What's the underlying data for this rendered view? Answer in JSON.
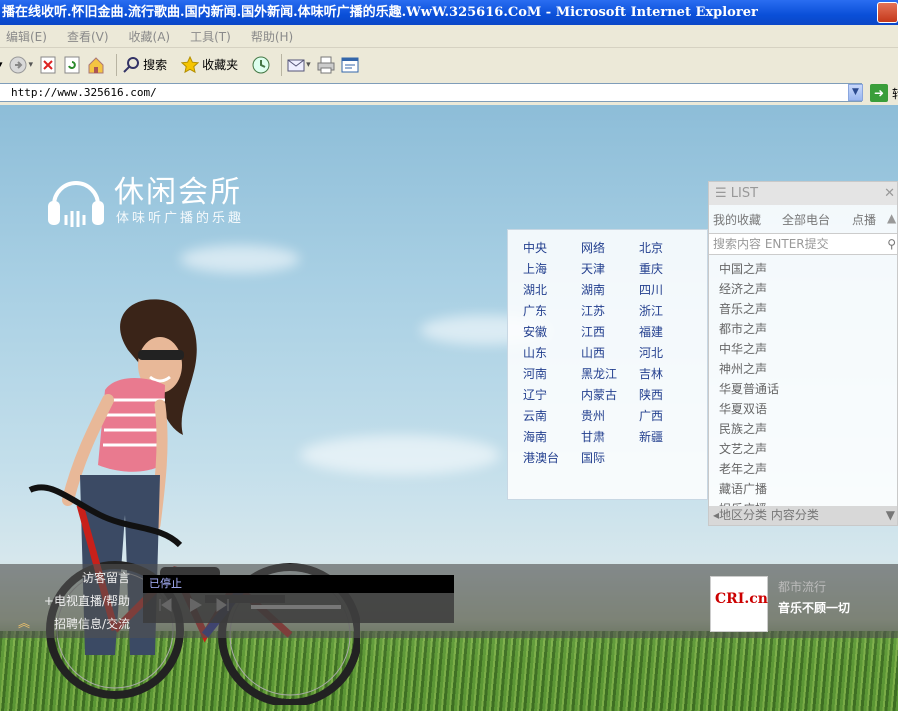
{
  "window": {
    "title": "播在线收听.怀旧金曲.流行歌曲.国内新闻.国外新闻.体味听广播的乐趣.WwW.325616.CoM - Microsoft Internet Explorer"
  },
  "menu": {
    "items": [
      "编辑(E)",
      "查看(V)",
      "收藏(A)",
      "工具(T)",
      "帮助(H)"
    ]
  },
  "toolbar": {
    "search_label": "搜索",
    "favorites_label": "收藏夹"
  },
  "address": {
    "url": "http://www.325616.com/",
    "go_label": "转"
  },
  "site": {
    "logo_title": "休闲会所",
    "logo_subtitle": "体味听广播的乐趣"
  },
  "regions": {
    "col1": [
      "中央",
      "上海",
      "湖北",
      "广东",
      "安徽",
      "山东",
      "河南",
      "辽宁",
      "云南",
      "海南",
      "港澳台"
    ],
    "col2": [
      "网络",
      "天津",
      "湖南",
      "江苏",
      "江西",
      "山西",
      "黑龙江",
      "内蒙古",
      "贵州",
      "甘肃",
      "国际"
    ],
    "col3": [
      "北京",
      "重庆",
      "四川",
      "浙江",
      "福建",
      "河北",
      "吉林",
      "陕西",
      "广西",
      "新疆"
    ]
  },
  "list": {
    "title": "LIST",
    "tab_favorites": "我的收藏",
    "tab_all": "全部电台",
    "tab_play": "点播",
    "search_placeholder": "搜索内容 ENTER提交",
    "items": [
      "中国之声",
      "经济之声",
      "音乐之声",
      "都市之声",
      "中华之声",
      "神州之声",
      "华夏普通话",
      "华夏双语",
      "民族之声",
      "文艺之声",
      "老年之声",
      "藏语广播",
      "娱乐广播"
    ],
    "footer": "◂地区分类 内容分类"
  },
  "bottom": {
    "links": [
      "访客留言",
      "+电视直播/帮助",
      "招聘信息/交流"
    ],
    "player_status": "已停止",
    "station_logo": "CRI.cn",
    "now_category": "都市流行",
    "now_title": "音乐不顾一切"
  },
  "colors": {
    "titlebar": "#0a4fd8",
    "region_link": "#24408f",
    "bottom_bar": "#505050"
  }
}
